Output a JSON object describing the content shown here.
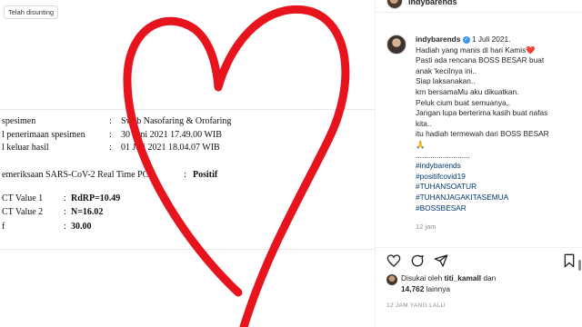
{
  "photo": {
    "pill": "Telah disunting",
    "doc_lines": [
      {
        "a": "spesimen",
        "b": ":",
        "c": "Swab Nasofaring & Orofaring"
      },
      {
        "a": "l penerimaan spesimen",
        "b": ":",
        "c": "30 Juni 2021 17.49.00 WIB"
      },
      {
        "a": "l keluar hasil",
        "b": ":",
        "c": "01 Juli 2021 18.04.07 WIB"
      },
      {
        "a": "emeriksaan SARS-CoV-2 Real Time PCR",
        "b": ":",
        "c": "Positif"
      },
      {
        "a": "CT Value 1",
        "b": ":",
        "c": "RdRP=10.49"
      },
      {
        "a": "CT Value 2",
        "b": ":",
        "c": "N=16.02"
      },
      {
        "a": "f",
        "b": ":",
        "c": "30.00"
      }
    ]
  },
  "header": {
    "username": "indybarends"
  },
  "post": {
    "username": "indybarends",
    "verified_mark": "✓",
    "date": "1 Juli 2021.",
    "lines": [
      "Hadiah yang manis di hari Kamis❤️",
      "Pasti ada rencana BOSS BESAR buat",
      "anak 'kecilnya ini..",
      "Siap laksanakan..",
      "krn bersamaMu aku dikuatkan.",
      "Peluk cium buat semuanya,.",
      "Jangan lupa berterima kasih buat nafas",
      "kita..",
      "itu hadiah termewah dari BOSS BESAR",
      "🙏",
      ".........................."
    ],
    "hashtags": [
      "#indybarends",
      "#positifcovid19",
      "#TUHANSOATUR",
      "#TUHANJAGAKITASEMUA",
      "#BOSSBESAR"
    ],
    "age": "12 jam"
  },
  "likes": {
    "prefix": "Disukai oleh",
    "user": "titi_kamall",
    "and": "dan",
    "count": "14,762",
    "suffix": "lainnya"
  },
  "timestamp": "12 JAM YANG LALU",
  "colors": {
    "heart": "#e8141d",
    "link": "#00376b",
    "verified": "#3897f0",
    "muted": "#8e8e8e"
  }
}
